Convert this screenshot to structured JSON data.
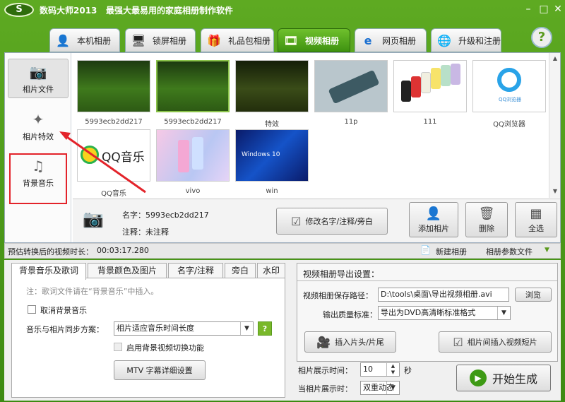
{
  "window": {
    "logo_text": "S",
    "title": "数码大师2013",
    "subtitle": "最强大最易用的家庭相册制作软件"
  },
  "tabs": [
    {
      "label": "本机相册",
      "icon": "person-icon"
    },
    {
      "label": "锁屏相册",
      "icon": "monitor-icon"
    },
    {
      "label": "礼品包相册",
      "icon": "gift-icon"
    },
    {
      "label": "视频相册",
      "icon": "film-icon",
      "active": true
    },
    {
      "label": "网页相册",
      "icon": "ie-icon"
    },
    {
      "label": "升级和注册",
      "icon": "globe-icon"
    }
  ],
  "help_label": "?",
  "sidebar": {
    "items": [
      {
        "label": "相片文件",
        "icon": "camera-icon"
      },
      {
        "label": "相片特效",
        "icon": "sparkle-icon"
      },
      {
        "label": "背景音乐",
        "icon": "music-note-icon"
      }
    ]
  },
  "thumbnails": [
    {
      "label": "5993ecb2dd217"
    },
    {
      "label": "5993ecb2dd217"
    },
    {
      "label": "特效"
    },
    {
      "label": "11p"
    },
    {
      "label": "111"
    },
    {
      "label": "QQ浏览器"
    },
    {
      "label": "QQ音乐"
    },
    {
      "label": "vivo"
    },
    {
      "label": "win"
    }
  ],
  "thumb_text": {
    "qq_music": "QQ音乐",
    "windows": "Windows 10",
    "qq_browser": "QQ浏览器"
  },
  "info": {
    "name_label": "名字：",
    "name_value": "5993ecb2dd217",
    "note_label": "注释：",
    "note_value": "未注释",
    "rename_button": "修改名字/注释/旁白",
    "add_button": "添加相片",
    "delete_button": "删除",
    "select_all_button": "全选"
  },
  "status": {
    "duration_label": "预估转换后的视频时长：",
    "duration_value": "00:03:17.280",
    "new_album": "新建相册",
    "album_params": "相册参数文件"
  },
  "bottom_tabs": [
    {
      "label": "背景音乐及歌词",
      "active": true
    },
    {
      "label": "背景颜色及图片"
    },
    {
      "label": "名字/注释"
    },
    {
      "label": "旁白"
    },
    {
      "label": "水印"
    }
  ],
  "music_pane": {
    "note": "注：歌词文件请在“背景音乐”中插入。",
    "cancel_music": "取消背景音乐",
    "sync_label": "音乐与相片同步方案：",
    "sync_value": "相片适应音乐时间长度",
    "bg_video_switch": "启用背景视频切换功能",
    "mtv_button": "MTV  字幕详细设置"
  },
  "export": {
    "title": "视频相册导出设置：",
    "path_label": "视频相册保存路径：",
    "path_value": "D:\\tools\\桌面\\导出视频相册.avi",
    "browse": "浏览",
    "quality_label": "输出质量标准：",
    "quality_value": "导出为DVD高清晰标准格式",
    "insert_head": "插入片头/片尾",
    "insert_clip": "相片间插入视频短片"
  },
  "timing": {
    "show_label": "相片展示时间：",
    "show_value": "10",
    "show_unit": "秒",
    "mode_label": "当相片展示时：",
    "mode_value": "双重动态"
  },
  "start_button": "开始生成"
}
